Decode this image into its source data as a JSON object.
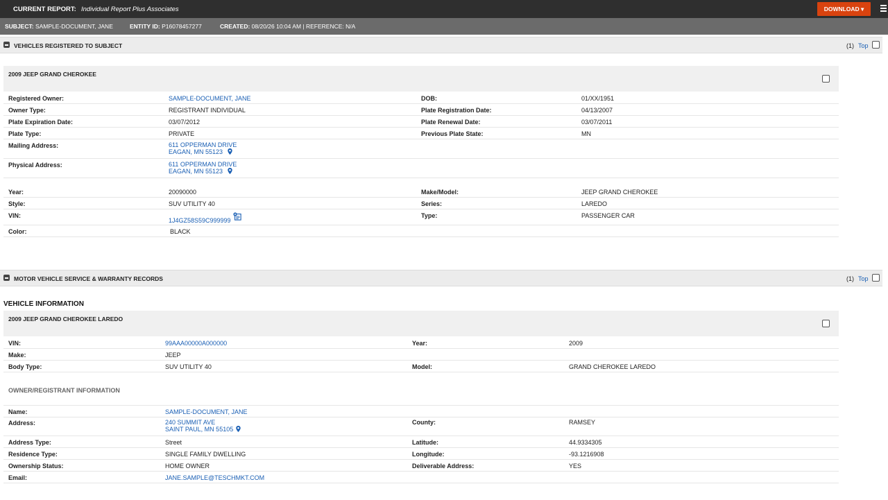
{
  "header": {
    "current_report_label": "CURRENT REPORT:",
    "current_report_value": "Individual Report Plus Associates",
    "download_label": "DOWNLOAD ▾"
  },
  "subject_bar": {
    "subject_label": "SUBJECT:",
    "subject_value": "SAMPLE-DOCUMENT, JANE",
    "entity_label": "ENTITY ID:",
    "entity_value": "P16078457277",
    "created_label": "CREATED:",
    "created_value": "08/20/26 10:04 AM | REFERENCE: N/A"
  },
  "section_vehicles": {
    "title": "VEHICLES REGISTERED TO SUBJECT",
    "count": "(1)",
    "top_link": "Top",
    "card_title": "2009 JEEP GRAND CHEROKEE",
    "rows": {
      "registered_owner": {
        "label": "Registered Owner:",
        "value": "SAMPLE-DOCUMENT, JANE"
      },
      "dob": {
        "label": "DOB:",
        "value": "01/XX/1951"
      },
      "owner_type": {
        "label": "Owner Type:",
        "value": "REGISTRANT INDIVIDUAL"
      },
      "plate_reg_date": {
        "label": "Plate Registration Date:",
        "value": "04/13/2007"
      },
      "plate_exp_date": {
        "label": "Plate Expiration Date:",
        "value": "03/07/2012"
      },
      "plate_renewal_date": {
        "label": "Plate Renewal Date:",
        "value": "03/07/2011"
      },
      "plate_type": {
        "label": "Plate Type:",
        "value": "PRIVATE"
      },
      "prev_plate_state": {
        "label": "Previous Plate State:",
        "value": "MN"
      },
      "mailing_address": {
        "label": "Mailing Address:",
        "line1": "611 OPPERMAN DRIVE",
        "line2": "EAGAN, MN 55123"
      },
      "physical_address": {
        "label": "Physical Address:",
        "line1": "611 OPPERMAN DRIVE",
        "line2": "EAGAN, MN 55123"
      },
      "year": {
        "label": "Year:",
        "value": "20090000"
      },
      "make_model": {
        "label": "Make/Model:",
        "value": "JEEP GRAND CHEROKEE"
      },
      "style": {
        "label": "Style:",
        "value": "SUV UTILITY 40"
      },
      "series": {
        "label": "Series:",
        "value": "LAREDO"
      },
      "vin": {
        "label": "VIN:",
        "value": "1J4GZ58S59C999999"
      },
      "type": {
        "label": "Type:",
        "value": "PASSENGER CAR"
      },
      "color": {
        "label": "Color:",
        "value": "BLACK"
      }
    }
  },
  "section_service": {
    "title": "MOTOR VEHICLE SERVICE & WARRANTY RECORDS",
    "count": "(1)",
    "top_link": "Top",
    "vehicle_info_heading": "VEHICLE INFORMATION",
    "card_title": "2009 JEEP GRAND CHEROKEE LAREDO",
    "rows": {
      "vin": {
        "label": "VIN:",
        "value": "99AAA00000A000000"
      },
      "year": {
        "label": "Year:",
        "value": "2009"
      },
      "make": {
        "label": "Make:",
        "value": "JEEP"
      },
      "body_type": {
        "label": "Body Type:",
        "value": "SUV UTILITY 40"
      },
      "model": {
        "label": "Model:",
        "value": "GRAND CHEROKEE LAREDO"
      }
    },
    "owner_heading": "OWNER/REGISTRANT INFORMATION",
    "owner_rows": {
      "name": {
        "label": "Name:",
        "value": "SAMPLE-DOCUMENT, JANE"
      },
      "address": {
        "label": "Address:",
        "line1": "240 SUMMIT AVE",
        "line2": "SAINT PAUL, MN 55105"
      },
      "county": {
        "label": "County:",
        "value": "RAMSEY"
      },
      "address_type": {
        "label": "Address Type:",
        "value": "Street"
      },
      "latitude": {
        "label": "Latitude:",
        "value": "44.9334305"
      },
      "residence_type": {
        "label": "Residence Type:",
        "value": "SINGLE FAMILY DWELLING"
      },
      "longitude": {
        "label": "Longitude:",
        "value": "-93.1216908"
      },
      "ownership_status": {
        "label": "Ownership Status:",
        "value": "HOME OWNER"
      },
      "deliverable_address": {
        "label": "Deliverable Address:",
        "value": "YES"
      },
      "email": {
        "label": "Email:",
        "value": "JANE.SAMPLE@TESCHMKT.COM"
      }
    }
  },
  "colors": {
    "topbar": "#2f2f2f",
    "subjectbar": "#6b6b6b",
    "download": "#d9430f",
    "link": "#1a5fb4"
  }
}
